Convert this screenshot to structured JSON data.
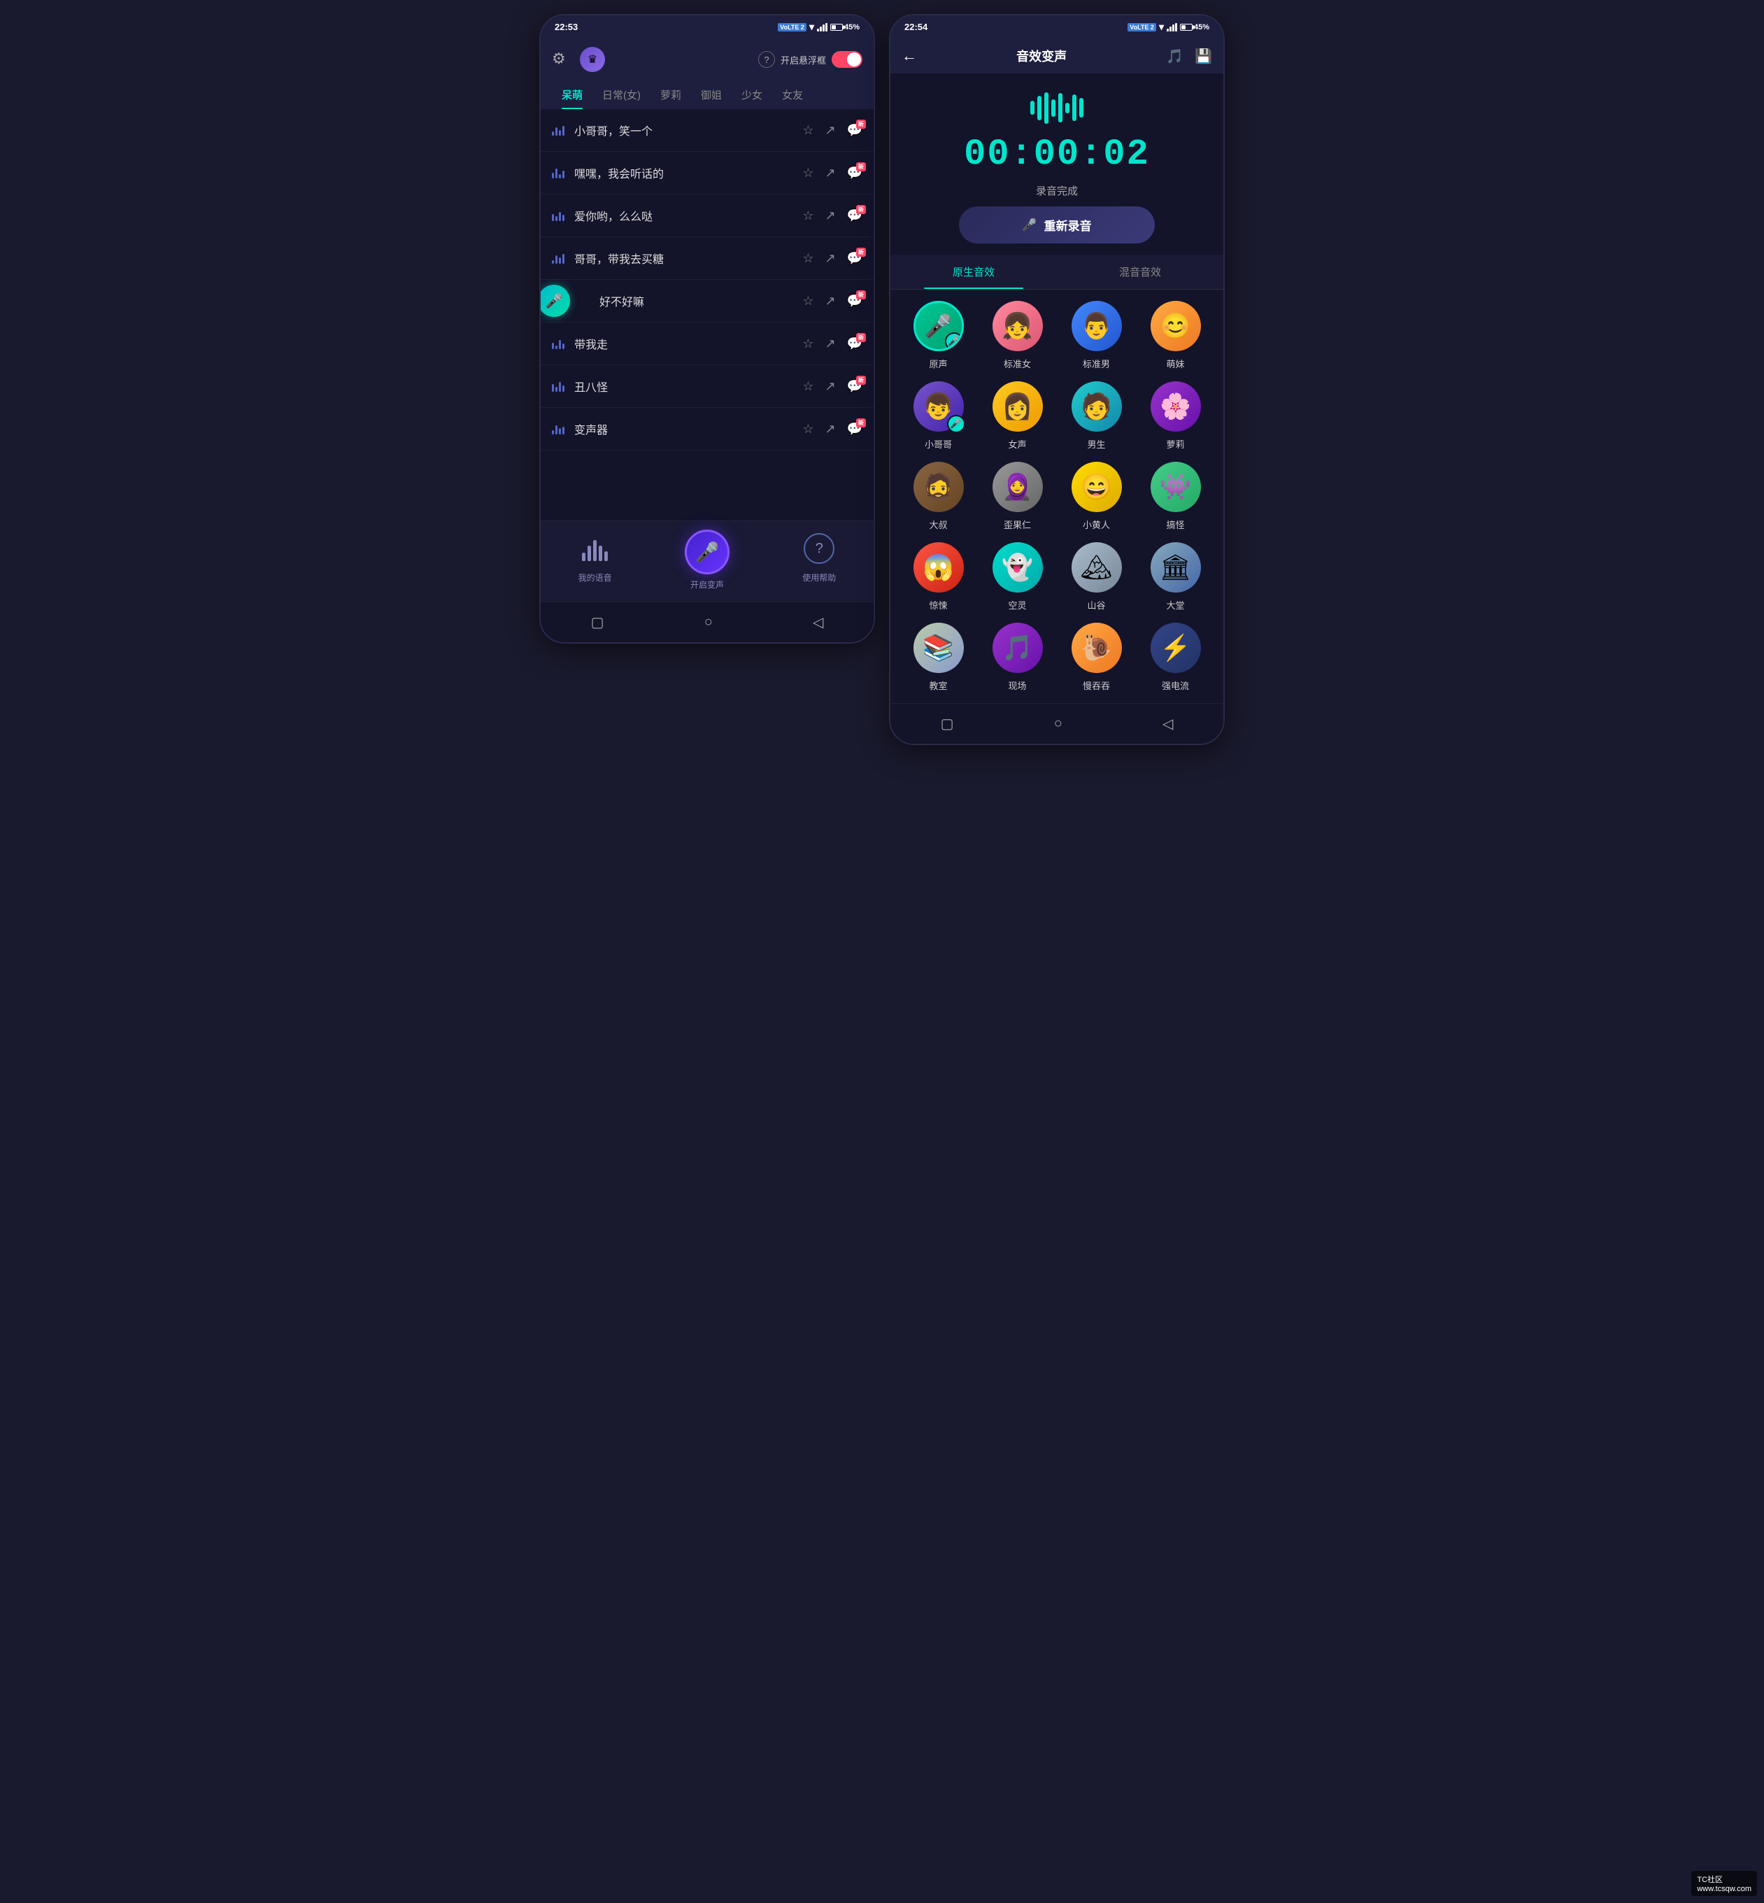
{
  "left_phone": {
    "status_bar": {
      "time": "22:53",
      "battery": "45%"
    },
    "header": {
      "float_label": "开启悬浮框"
    },
    "tabs": [
      {
        "label": "呆萌",
        "active": true
      },
      {
        "label": "日常(女)",
        "active": false
      },
      {
        "label": "萝莉",
        "active": false
      },
      {
        "label": "御姐",
        "active": false
      },
      {
        "label": "少女",
        "active": false
      },
      {
        "label": "女友",
        "active": false
      }
    ],
    "voice_items": [
      {
        "name": "小哥哥，笑一个"
      },
      {
        "name": "嘿嘿，我会听话的"
      },
      {
        "name": "爱你哟，么么哒"
      },
      {
        "name": "哥哥，带我去买糖"
      },
      {
        "name": "好不好嘛"
      },
      {
        "name": "带我走"
      },
      {
        "name": "丑八怪"
      },
      {
        "name": "变声器"
      }
    ],
    "bottom_nav": {
      "my_voice": "我的语音",
      "start_change": "开启变声",
      "help": "使用帮助"
    }
  },
  "right_phone": {
    "status_bar": {
      "time": "22:54",
      "battery": "45%"
    },
    "header": {
      "title": "音效变声",
      "back": "←"
    },
    "recording": {
      "timer": "00:00:02",
      "status": "录音完成",
      "re_record": "重新录音"
    },
    "effect_tabs": [
      {
        "label": "原生音效",
        "active": true
      },
      {
        "label": "混音音效",
        "active": false
      }
    ],
    "effects": [
      {
        "label": "原声",
        "avatar_class": "av-green",
        "emoji": "🎤",
        "selected": true
      },
      {
        "label": "标准女",
        "avatar_class": "av-pink",
        "emoji": "👧"
      },
      {
        "label": "标准男",
        "avatar_class": "av-blue",
        "emoji": "👨"
      },
      {
        "label": "萌妹",
        "avatar_class": "av-orange",
        "emoji": "😊"
      },
      {
        "label": "小哥哥",
        "avatar_class": "av-purple",
        "emoji": "👦",
        "has_mic": true
      },
      {
        "label": "女声",
        "avatar_class": "av-yellow",
        "emoji": "👩"
      },
      {
        "label": "男生",
        "avatar_class": "av-teal",
        "emoji": "🧑"
      },
      {
        "label": "萝莉",
        "avatar_class": "av-violet",
        "emoji": "🌸"
      },
      {
        "label": "大叔",
        "avatar_class": "av-brown",
        "emoji": "🧔"
      },
      {
        "label": "歪果仁",
        "avatar_class": "av-gray",
        "emoji": "🧕"
      },
      {
        "label": "小黄人",
        "avatar_class": "av-gold",
        "emoji": "😄"
      },
      {
        "label": "搞怪",
        "avatar_class": "av-mint",
        "emoji": "👾"
      },
      {
        "label": "惊悚",
        "avatar_class": "av-red",
        "emoji": "😱"
      },
      {
        "label": "空灵",
        "avatar_class": "av-cyan",
        "emoji": "👻"
      },
      {
        "label": "山谷",
        "avatar_class": "av-scene",
        "emoji": "🏔"
      },
      {
        "label": "大堂",
        "avatar_class": "av-scene2",
        "emoji": "🏛"
      },
      {
        "label": "教室",
        "avatar_class": "av-scene3",
        "emoji": "📚"
      },
      {
        "label": "现场",
        "avatar_class": "av-violet",
        "emoji": "🎵"
      },
      {
        "label": "慢吞吞",
        "avatar_class": "av-orange",
        "emoji": "🐌"
      },
      {
        "label": "强电流",
        "avatar_class": "av-darkblue",
        "emoji": "⚡"
      }
    ]
  },
  "watermark": {
    "line1": "TC社区",
    "line2": "www.tcsqw.com"
  }
}
